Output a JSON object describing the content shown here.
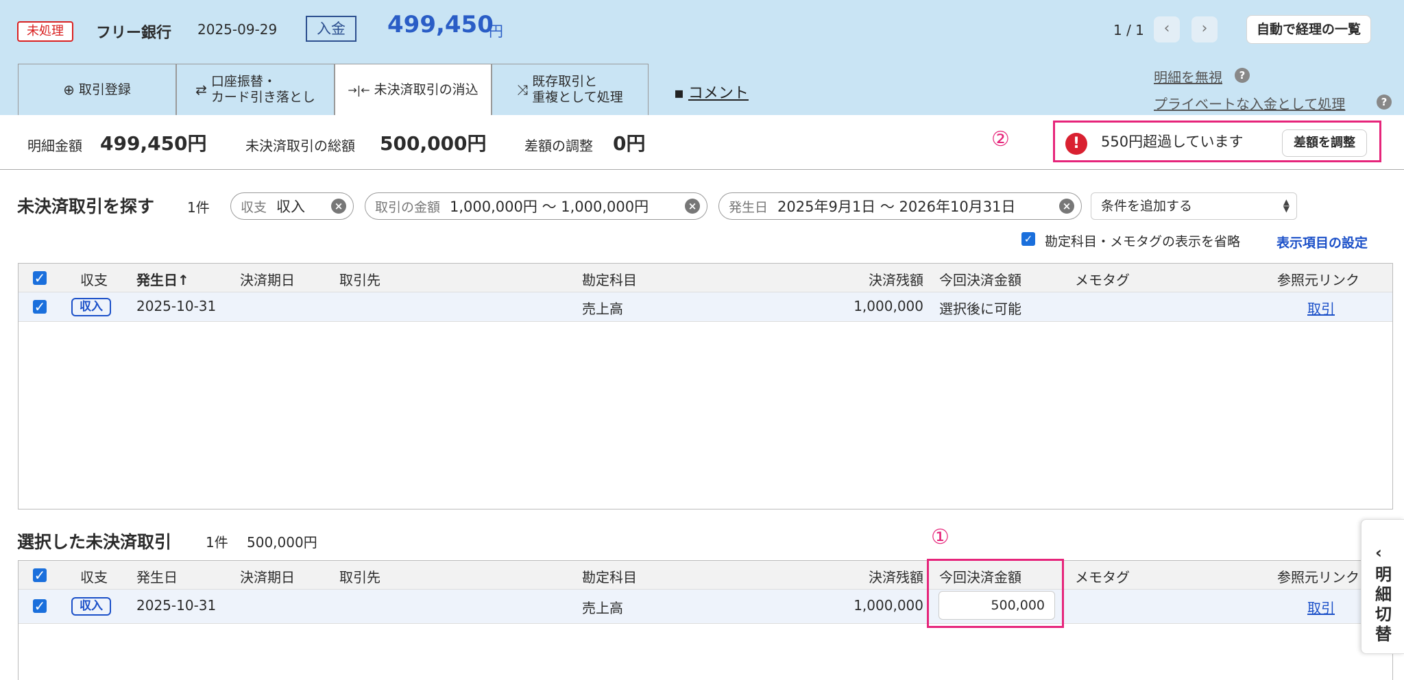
{
  "header": {
    "status": "未処理",
    "bank": "フリー銀行",
    "date": "2025-09-29",
    "type": "入金",
    "amount": "499,450",
    "currency": "円",
    "page": "1 / 1",
    "prev_icon": "chevron-left-icon",
    "next_icon": "chevron-right-icon",
    "list_button": "自動で経理の一覧"
  },
  "tabs": [
    {
      "icon": "plus-circle-icon",
      "label": "取引登録"
    },
    {
      "icon": "transfer-icon",
      "line1": "口座振替・",
      "line2": "カード引き落とし"
    },
    {
      "icon": "merge-icon",
      "label": "未決済取引の消込"
    },
    {
      "icon": "duplicate-icon",
      "line1": "既存取引と",
      "line2": "重複として処理"
    }
  ],
  "comment_link": "コメント",
  "side_links": {
    "ignore": "明細を無視",
    "private": "プライベートな入金として処理",
    "help": "?"
  },
  "summary": {
    "statement_label": "明細金額",
    "statement_value": "499,450円",
    "unsettled_label": "未決済取引の総額",
    "unsettled_value": "500,000円",
    "adjust_label": "差額の調整",
    "adjust_value": "0円",
    "marker2": "②",
    "alert_text": "550円超過しています",
    "alert_icon": "!",
    "adjust_button": "差額を調整"
  },
  "search": {
    "title": "未決済取引を探す",
    "count": "1件",
    "chips": [
      {
        "key": "収支",
        "value": "収入"
      },
      {
        "key": "取引の金額",
        "value": "1,000,000円 〜 1,000,000円"
      },
      {
        "key": "発生日",
        "value": "2025年9月1日 〜 2026年10月31日"
      }
    ],
    "chip_clear": "×",
    "add_condition": "条件を追加する",
    "omit_label": "勘定科目・メモタグの表示を省略",
    "settings_link": "表示項目の設定"
  },
  "table1": {
    "headers": {
      "type": "収支",
      "date": "発生日",
      "sort": "↑",
      "due": "決済期日",
      "partner": "取引先",
      "account": "勘定科目",
      "balance": "決済残額",
      "pay": "今回決済金額",
      "memo": "メモタグ",
      "ref": "参照元リンク"
    },
    "row": {
      "type": "収入",
      "date": "2025-10-31",
      "account": "売上高",
      "balance": "1,000,000",
      "pay": "選択後に可能",
      "ref": "取引"
    }
  },
  "selected": {
    "title": "選択した未決済取引",
    "count": "1件",
    "total": "500,000円",
    "marker1": "①"
  },
  "table2": {
    "headers": {
      "type": "収支",
      "date": "発生日",
      "due": "決済期日",
      "partner": "取引先",
      "account": "勘定科目",
      "balance": "決済残額",
      "pay": "今回決済金額",
      "memo": "メモタグ",
      "ref": "参照元リンク"
    },
    "row": {
      "type": "収入",
      "date": "2025-10-31",
      "account": "売上高",
      "balance": "1,000,000",
      "pay": "500,000",
      "ref": "取引"
    }
  },
  "side_toggle": {
    "label": "明細切替",
    "icon": "chevron-left-icon"
  }
}
